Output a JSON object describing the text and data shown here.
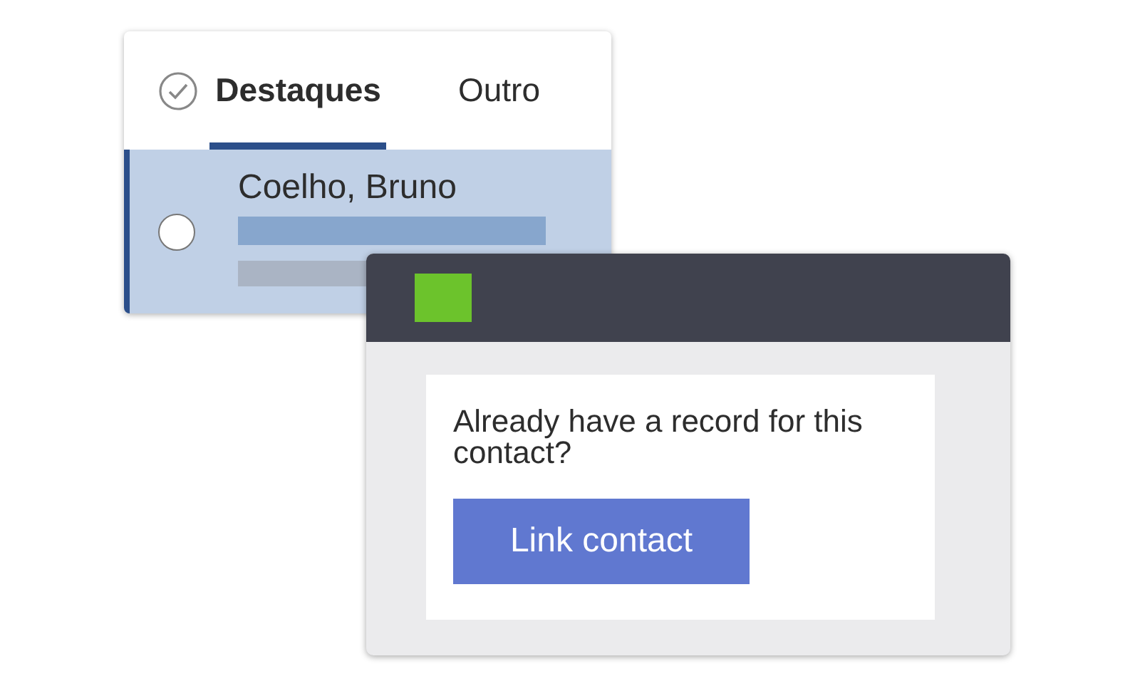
{
  "mail_window": {
    "tabs": [
      {
        "label": "Destaques",
        "selected": true
      },
      {
        "label": "Outro",
        "selected": false
      }
    ],
    "messages": [
      {
        "sender": "Coelho, Bruno",
        "selected": true,
        "checked": false
      }
    ]
  },
  "dialog": {
    "prompt": "Already have a record for this contact?",
    "button": "Link contact"
  }
}
